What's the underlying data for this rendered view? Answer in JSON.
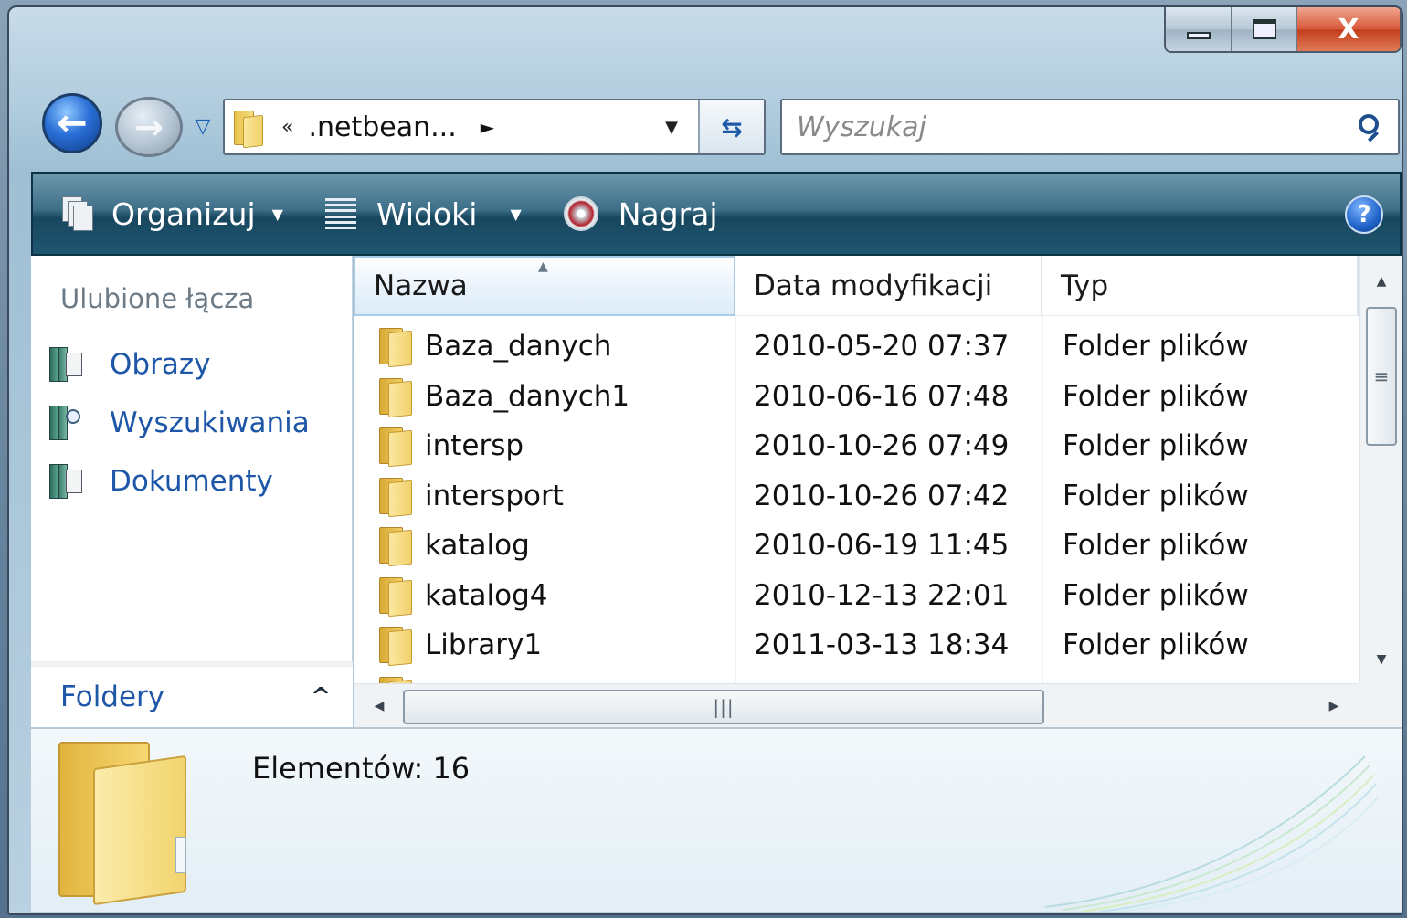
{
  "window": {
    "caption": {
      "minimize": "▁",
      "maximize": "□",
      "close": "X"
    }
  },
  "nav": {
    "back_icon": "arrow-left",
    "forward_icon": "arrow-right",
    "address": {
      "chevron": "«",
      "path": ".netbean...",
      "arrow": "►"
    },
    "search": {
      "placeholder": "Wyszukaj"
    }
  },
  "toolbar": {
    "organize": "Organizuj",
    "views": "Widoki",
    "burn": "Nagraj",
    "help": "?"
  },
  "sidebar": {
    "favorites_title": "Ulubione łącza",
    "items": [
      {
        "label": "Obrazy",
        "icon": "pictures-library-icon"
      },
      {
        "label": "Wyszukiwania",
        "icon": "searches-library-icon"
      },
      {
        "label": "Dokumenty",
        "icon": "documents-library-icon"
      }
    ],
    "folders_label": "Foldery"
  },
  "file_list": {
    "columns": {
      "name": "Nazwa",
      "date": "Data modyfikacji",
      "type": "Typ"
    },
    "rows": [
      {
        "name": "Baza_danych",
        "date": "2010-05-20 07:37",
        "type": "Folder plików"
      },
      {
        "name": "Baza_danych1",
        "date": "2010-06-16 07:48",
        "type": "Folder plików"
      },
      {
        "name": "intersp",
        "date": "2010-10-26 07:49",
        "type": "Folder plików"
      },
      {
        "name": "intersport",
        "date": "2010-10-26 07:42",
        "type": "Folder plików"
      },
      {
        "name": "katalog",
        "date": "2010-06-19 11:45",
        "type": "Folder plików"
      },
      {
        "name": "katalog4",
        "date": "2010-12-13 22:01",
        "type": "Folder plików"
      },
      {
        "name": "Library1",
        "date": "2011-03-13 18:34",
        "type": "Folder plików"
      }
    ]
  },
  "details": {
    "elements_count": "Elementów: 16"
  },
  "colors": {
    "link": "#1e56a8",
    "command_bar": "#1e5670",
    "close_button": "#c23e1c"
  }
}
